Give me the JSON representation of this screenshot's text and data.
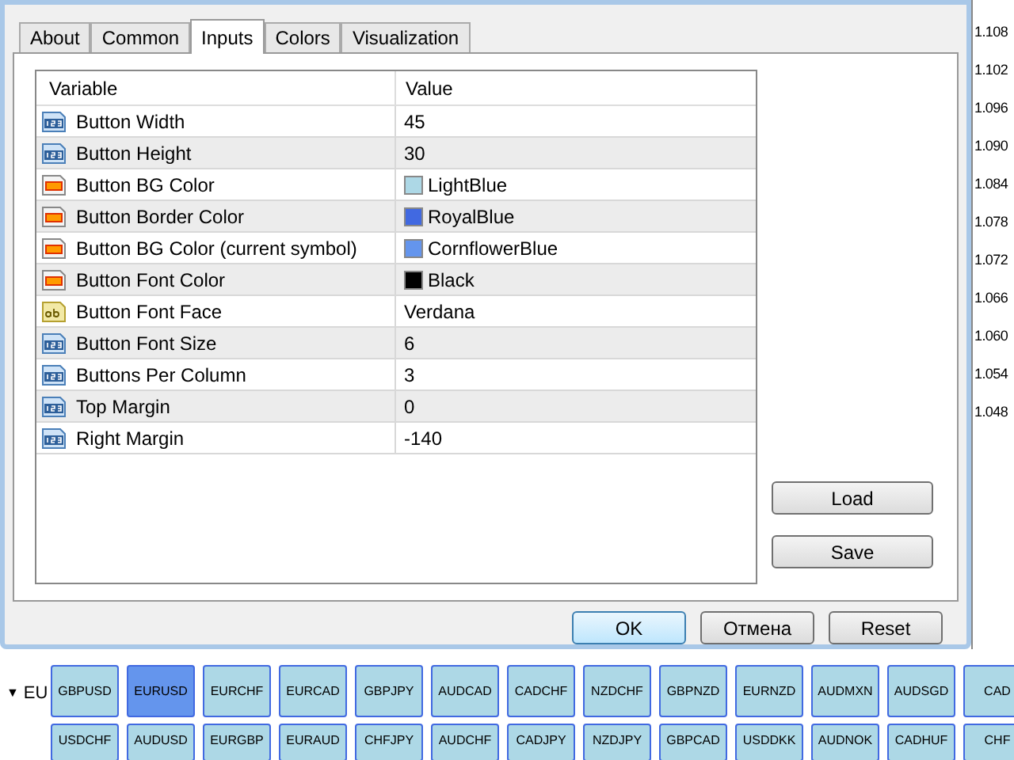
{
  "tabs": [
    {
      "label": "About",
      "selected": false
    },
    {
      "label": "Common",
      "selected": false
    },
    {
      "label": "Inputs",
      "selected": true
    },
    {
      "label": "Colors",
      "selected": false
    },
    {
      "label": "Visualization",
      "selected": false
    }
  ],
  "table": {
    "columns": [
      "Variable",
      "Value"
    ],
    "rows": [
      {
        "kind": "int",
        "variable": "Button Width",
        "value": "45"
      },
      {
        "kind": "int",
        "variable": "Button Height",
        "value": "30"
      },
      {
        "kind": "color",
        "variable": "Button BG Color",
        "value": "LightBlue",
        "color": "#add8e6"
      },
      {
        "kind": "color",
        "variable": "Button Border Color",
        "value": "RoyalBlue",
        "color": "#4169e1"
      },
      {
        "kind": "color",
        "variable": "Button BG Color (current symbol)",
        "value": "CornflowerBlue",
        "color": "#6495ed"
      },
      {
        "kind": "color",
        "variable": "Button Font Color",
        "value": "Black",
        "color": "#000000"
      },
      {
        "kind": "string",
        "variable": "Button Font Face",
        "value": "Verdana"
      },
      {
        "kind": "int",
        "variable": "Button Font Size",
        "value": "6"
      },
      {
        "kind": "int",
        "variable": "Buttons Per Column",
        "value": "3"
      },
      {
        "kind": "int",
        "variable": "Top Margin",
        "value": "0"
      },
      {
        "kind": "int",
        "variable": "Right Margin",
        "value": "-140"
      }
    ]
  },
  "side_buttons": [
    "Load",
    "Save"
  ],
  "dialog_buttons": [
    {
      "label": "OK",
      "default": true
    },
    {
      "label": "Отмена",
      "default": false
    },
    {
      "label": "Reset",
      "default": false
    }
  ],
  "price_axis": [
    "1.108",
    "1.102",
    "1.096",
    "1.090",
    "1.084",
    "1.078",
    "1.072",
    "1.066",
    "1.060",
    "1.054",
    "1.048"
  ],
  "chart_label": {
    "arrow": "▼",
    "text": "EU"
  },
  "symbol_rows": [
    [
      {
        "label": "GBPUSD",
        "selected": false
      },
      {
        "label": "EURUSD",
        "selected": true
      },
      {
        "label": "EURCHF",
        "selected": false
      },
      {
        "label": "EURCAD",
        "selected": false
      },
      {
        "label": "GBPJPY",
        "selected": false
      },
      {
        "label": "AUDCAD",
        "selected": false
      },
      {
        "label": "CADCHF",
        "selected": false
      },
      {
        "label": "NZDCHF",
        "selected": false
      },
      {
        "label": "GBPNZD",
        "selected": false
      },
      {
        "label": "EURNZD",
        "selected": false
      },
      {
        "label": "AUDMXN",
        "selected": false
      },
      {
        "label": "AUDSGD",
        "selected": false
      },
      {
        "label": "CAD",
        "selected": false
      }
    ],
    [
      {
        "label": "USDCHF",
        "selected": false
      },
      {
        "label": "AUDUSD",
        "selected": false
      },
      {
        "label": "EURGBP",
        "selected": false
      },
      {
        "label": "EURAUD",
        "selected": false
      },
      {
        "label": "CHFJPY",
        "selected": false
      },
      {
        "label": "AUDCHF",
        "selected": false
      },
      {
        "label": "CADJPY",
        "selected": false
      },
      {
        "label": "NZDJPY",
        "selected": false
      },
      {
        "label": "GBPCAD",
        "selected": false
      },
      {
        "label": "USDDKK",
        "selected": false
      },
      {
        "label": "AUDNOK",
        "selected": false
      },
      {
        "label": "CADHUF",
        "selected": false
      },
      {
        "label": "CHF",
        "selected": false
      }
    ]
  ]
}
